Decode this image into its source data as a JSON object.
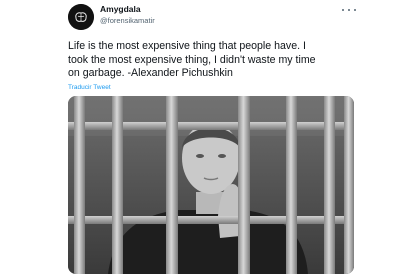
{
  "tweet": {
    "display_name": "Amygdala",
    "handle": "@forensikamatir",
    "lines": [
      "Life is the most expensive thing that people have. I",
      "took the most expensive thing, I didn't waste my time",
      "on garbage. -Alexander Pichushkin"
    ],
    "translate_label": "Traducir Tweet",
    "more_icon": "more-horizontal-icon",
    "avatar_icon": "brain-logo-icon",
    "media_description_colors": {
      "link": "#1d9bf0",
      "text": "#0f1419",
      "secondary": "#536471"
    }
  }
}
